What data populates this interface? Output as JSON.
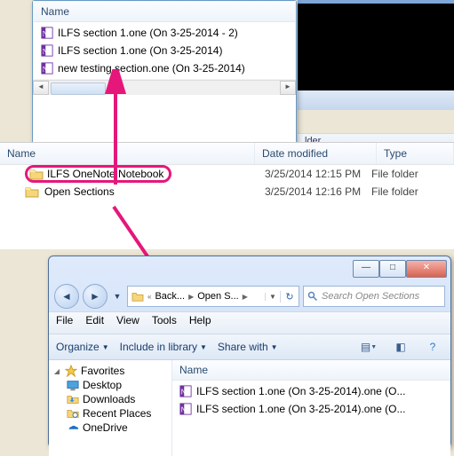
{
  "popup": {
    "header": "Name",
    "files": [
      {
        "name": "ILFS section 1.one (On 3-25-2014 - 2)"
      },
      {
        "name": "ILFS section 1.one (On 3-25-2014)"
      },
      {
        "name": "new testing section.one (On 3-25-2014)"
      }
    ]
  },
  "middle": {
    "columns": {
      "name": "Name",
      "date": "Date modified",
      "type": "Type"
    },
    "folder_bar_text": "lder",
    "rows": [
      {
        "name": "ILFS OneNote Notebook",
        "date": "3/25/2014 12:15 PM",
        "type": "File folder",
        "highlight": true
      },
      {
        "name": "Open Sections",
        "date": "3/25/2014 12:16 PM",
        "type": "File folder",
        "highlight": false
      }
    ]
  },
  "explorer": {
    "nav": {
      "back": "◄",
      "fwd": "►"
    },
    "breadcrumb": [
      {
        "label": "Back...",
        "hasIcon": true
      },
      {
        "label": "Open S..."
      }
    ],
    "search_placeholder": "Search Open Sections",
    "menubar": [
      "File",
      "Edit",
      "View",
      "Tools",
      "Help"
    ],
    "toolbar": {
      "organize": "Organize",
      "include": "Include in library",
      "share": "Share with"
    },
    "navpane": {
      "favorites": "Favorites",
      "items": [
        {
          "label": "Desktop",
          "icon": "desktop"
        },
        {
          "label": "Downloads",
          "icon": "downloads"
        },
        {
          "label": "Recent Places",
          "icon": "recent"
        },
        {
          "label": "OneDrive",
          "icon": "onedrive"
        }
      ]
    },
    "filepane": {
      "header": "Name",
      "files": [
        {
          "name": "ILFS section 1.one (On 3-25-2014).one (O..."
        },
        {
          "name": "ILFS section 1.one (On 3-25-2014).one (O..."
        }
      ]
    }
  },
  "colors": {
    "accent": "#e5177b"
  }
}
